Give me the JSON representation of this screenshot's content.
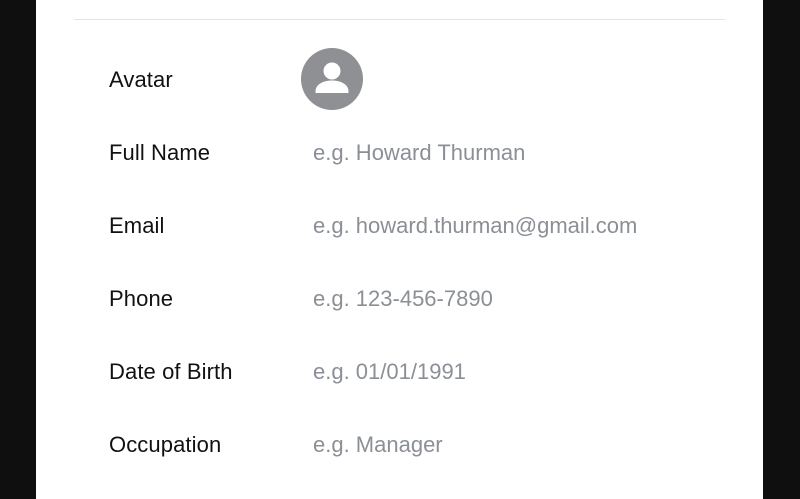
{
  "form": {
    "fields": [
      {
        "label": "Avatar",
        "icon": "person-icon"
      },
      {
        "label": "Full Name",
        "placeholder": "e.g. Howard Thurman",
        "value": ""
      },
      {
        "label": "Email",
        "placeholder": "e.g. howard.thurman@gmail.com",
        "value": ""
      },
      {
        "label": "Phone",
        "placeholder": "e.g. 123-456-7890",
        "value": ""
      },
      {
        "label": "Date of Birth",
        "placeholder": "e.g. 01/01/1991",
        "value": ""
      },
      {
        "label": "Occupation",
        "placeholder": "e.g. Manager",
        "value": ""
      }
    ]
  },
  "colors": {
    "background": "#0f0f0f",
    "card": "#ffffff",
    "label": "#111111",
    "placeholder": "#8b8f96",
    "avatar": "#8f9094",
    "divider": "#e3e4e6"
  }
}
